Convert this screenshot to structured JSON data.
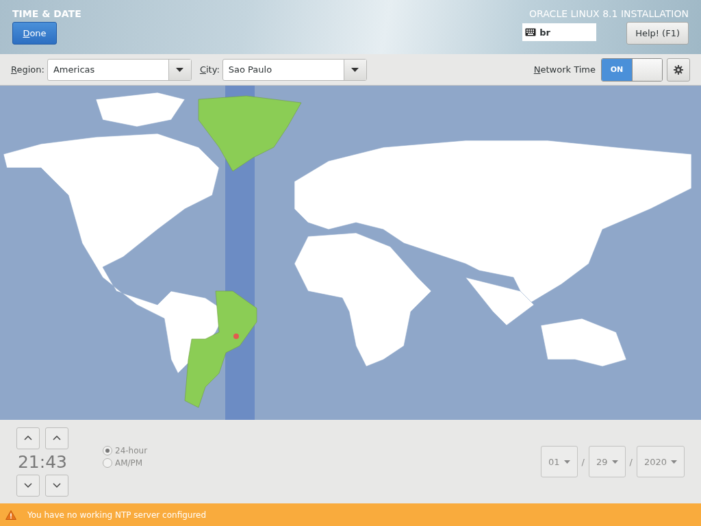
{
  "header": {
    "title": "TIME & DATE",
    "done_button": "Done",
    "product": "ORACLE LINUX 8.1 INSTALLATION",
    "keyboard_layout": "br",
    "help_button": "Help! (F1)"
  },
  "toolbar": {
    "region_label": "Region:",
    "region": "Americas",
    "city_label": "City:",
    "city": "Sao Paulo",
    "network_time_label": "Network Time",
    "network_time": {
      "on": true,
      "label": "ON"
    }
  },
  "time": {
    "hours": "21",
    "separator": ":",
    "minutes": "43"
  },
  "formats": [
    {
      "label": "24-hour",
      "selected": true
    },
    {
      "label": "AM/PM",
      "selected": false
    }
  ],
  "date": [
    {
      "value": "01"
    },
    {
      "separator": "/"
    },
    {
      "value": "29"
    },
    {
      "separator": "/"
    },
    {
      "value": "2020"
    }
  ],
  "status_bar": {
    "message": "You have no working NTP server configured"
  }
}
